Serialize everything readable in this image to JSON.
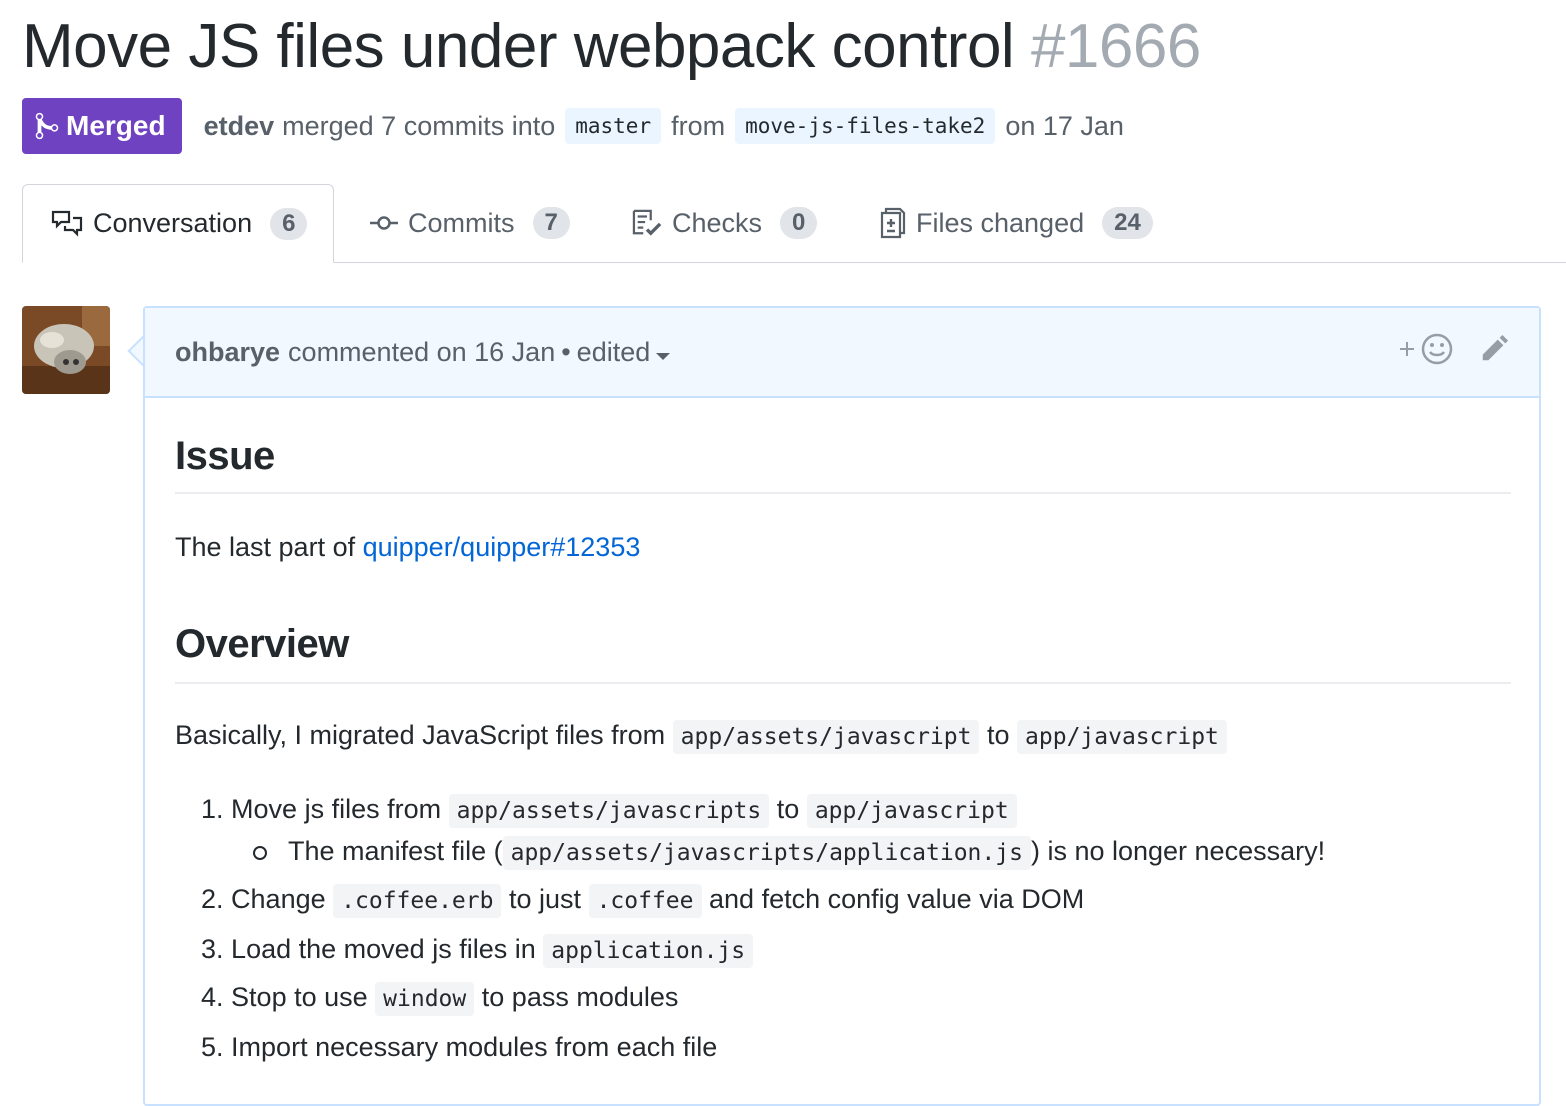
{
  "pr": {
    "title": "Move JS files under webpack control",
    "number": "#1666",
    "state": "Merged",
    "merged_by": "etdev",
    "merged_text": "merged 7 commits into",
    "base_branch": "master",
    "from_text": "from",
    "head_branch": "move-js-files-take2",
    "date_text": "on 17 Jan"
  },
  "tabs": [
    {
      "label": "Conversation",
      "count": "6",
      "icon": "comment-discussion-icon"
    },
    {
      "label": "Commits",
      "count": "7",
      "icon": "git-commit-icon"
    },
    {
      "label": "Checks",
      "count": "0",
      "icon": "checklist-icon"
    },
    {
      "label": "Files changed",
      "count": "24",
      "icon": "diff-icon"
    }
  ],
  "comment": {
    "author": "ohbarye",
    "commented_text": "commented on 16 Jan",
    "separator": "•",
    "edited_text": "edited",
    "reaction_icon": "add-reaction-icon",
    "edit_icon": "pencil-icon",
    "issue_heading": "Issue",
    "issue_text": "The last part of",
    "issue_link": "quipper/quipper#12353",
    "overview_heading": "Overview",
    "overview_text_1": "Basically, I migrated JavaScript files from",
    "overview_code_1": "app/assets/javascript",
    "overview_text_2": "to",
    "overview_code_2": "app/javascript",
    "list": {
      "item1": {
        "num": "1.",
        "text_a": "Move js files from",
        "code_a": "app/assets/javascripts",
        "text_b": "to",
        "code_b": "app/javascript"
      },
      "sub1": {
        "text_a": "The manifest file (",
        "code_a": "app/assets/javascripts/application.js",
        "text_b": ") is no longer necessary!"
      },
      "item2": {
        "num": "2.",
        "text_a": "Change",
        "code_a": ".coffee.erb",
        "text_b": "to just",
        "code_b": ".coffee",
        "text_c": "and fetch config value via DOM"
      },
      "item3": {
        "num": "3.",
        "text_a": "Load the moved js files in",
        "code_a": "application.js"
      },
      "item4": {
        "num": "4.",
        "text_a": "Stop to use",
        "code_a": "window",
        "text_b": "to pass modules"
      },
      "item5": {
        "num": "5.",
        "text_a": "Import necessary modules from each file"
      }
    }
  }
}
